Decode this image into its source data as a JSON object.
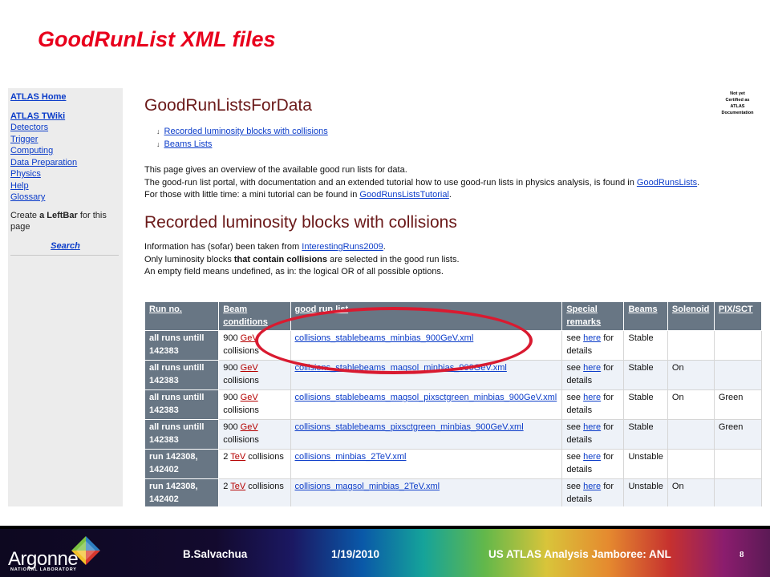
{
  "slide": {
    "title": "GoodRunList XML files",
    "page_number": "8"
  },
  "leftbar": {
    "home": "ATLAS Home",
    "twiki": "ATLAS TWiki",
    "links": [
      "Detectors",
      "Trigger",
      "Computing",
      "Data Preparation",
      "Physics",
      "Help",
      "Glossary"
    ],
    "create_prefix": "Create",
    "create_link": "a LeftBar",
    "create_suffix": "for this page",
    "search": "Search"
  },
  "page": {
    "title": "GoodRunListsForData",
    "certified_note": [
      "Not yet",
      "Certified as",
      "ATLAS",
      "Documentation"
    ],
    "toc": [
      "Recorded luminosity blocks with collisions",
      "Beams Lists"
    ],
    "intro_line1": "This page gives an overview of the available good run lists for data.",
    "intro_line2_a": "The good-run list portal, with documentation and an extended tutorial how to use good-run lists in physics analysis, is found in",
    "intro_line2_link": "GoodRunsLists",
    "intro_line3_a": "For those with little time: a mini tutorial can be found in",
    "intro_line3_link": "GoodRunsListsTutorial",
    "section_title": "Recorded luminosity blocks with collisions",
    "info_line1_a": "Information has (sofar) been taken from",
    "info_line1_link": "InterestingRuns2009",
    "info_line2_a": "Only luminosity blocks",
    "info_line2_bold": "that contain collisions",
    "info_line2_b": "are selected in the good run lists.",
    "info_line3": "An empty field means undefined, as in: the logical OR of all possible options."
  },
  "table": {
    "headers": [
      "Run no.",
      "Beam conditions",
      "good run list",
      "Special remarks",
      "Beams",
      "Solenoid",
      "PIX/SCT"
    ],
    "rows": [
      {
        "run": "all runs untill 142383",
        "energy": "900",
        "unit": "GeV",
        "suffix": "collisions",
        "file": "collisions_stablebeams_minbias_900GeV.xml",
        "remark_a": "see",
        "remark_link": "here",
        "remark_b": "for details",
        "beams": "Stable",
        "solenoid": "",
        "pix": ""
      },
      {
        "run": "all runs untill 142383",
        "energy": "900",
        "unit": "GeV",
        "suffix": "collisions",
        "file": "collisions_stablebeams_magsol_minbias_900GeV.xml",
        "remark_a": "see",
        "remark_link": "here",
        "remark_b": "for details",
        "beams": "Stable",
        "solenoid": "On",
        "pix": ""
      },
      {
        "run": "all runs untill 142383",
        "energy": "900",
        "unit": "GeV",
        "suffix": "collisions",
        "file": "collisions_stablebeams_magsol_pixsctgreen_minbias_900GeV.xml",
        "remark_a": "see",
        "remark_link": "here",
        "remark_b": "for details",
        "beams": "Stable",
        "solenoid": "On",
        "pix": "Green"
      },
      {
        "run": "all runs untill 142383",
        "energy": "900",
        "unit": "GeV",
        "suffix": "collisions",
        "file": "collisions_stablebeams_pixsctgreen_minbias_900GeV.xml",
        "remark_a": "see",
        "remark_link": "here",
        "remark_b": "for details",
        "beams": "Stable",
        "solenoid": "",
        "pix": "Green"
      },
      {
        "run": "run 142308, 142402",
        "energy": "2",
        "unit": "TeV",
        "suffix": "collisions",
        "file": "collisions_minbias_2TeV.xml",
        "remark_a": "see",
        "remark_link": "here",
        "remark_b": "for details",
        "beams": "Unstable",
        "solenoid": "",
        "pix": ""
      },
      {
        "run": "run 142308, 142402",
        "energy": "2",
        "unit": "TeV",
        "suffix": "collisions",
        "file": "collisions_magsol_minbias_2TeV.xml",
        "remark_a": "see",
        "remark_link": "here",
        "remark_b": "for details",
        "beams": "Unstable",
        "solenoid": "On",
        "pix": ""
      }
    ]
  },
  "footer": {
    "logo": "Argonne",
    "logo_sub": "NATIONAL LABORATORY",
    "author": "B.Salvachua",
    "date": "1/19/2010",
    "event": "US ATLAS Analysis Jamboree: ANL"
  },
  "colors": {
    "title": "#e8001c",
    "highlight_ellipse": "#d91a30",
    "table_header": "#687684",
    "link": "#0b3cc9",
    "heading": "#6b1a1a"
  }
}
